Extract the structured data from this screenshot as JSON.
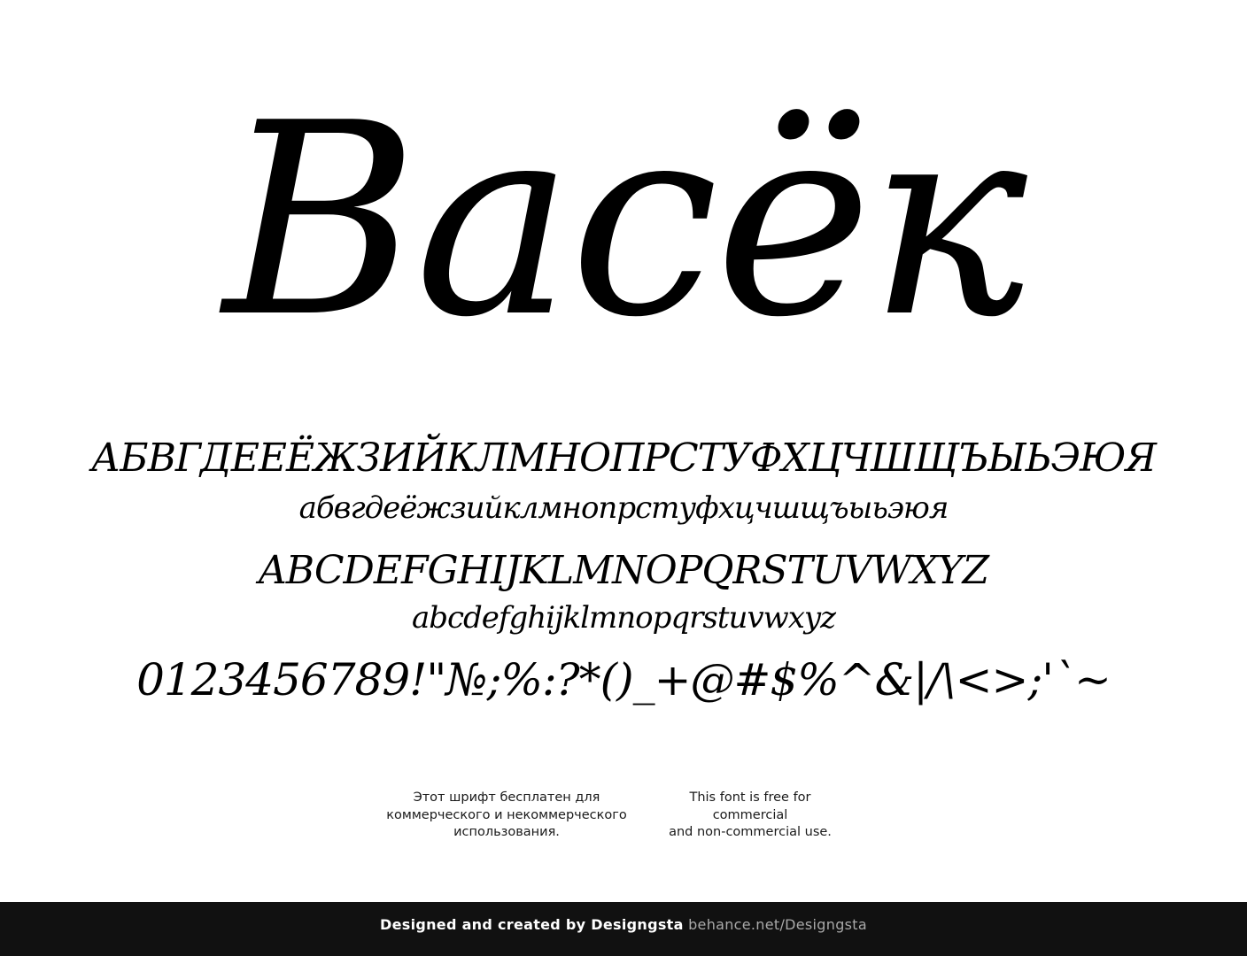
{
  "title": "Васёк",
  "glyph_lines": {
    "cyrillic_upper": "АБВГДЕЕЁЖЗИЙКЛМНОПРСТУФХЦЧШЩЪЫЬЭЮЯ",
    "cyrillic_lower": "абвгдеёжзийклмнопрстуфхцчшщъыьэюя",
    "latin_upper": "ABCDEFGHIJKLMNOPQRSTUVWXYZ",
    "latin_lower": "abcdefghijklmnopqrstuvwxyz",
    "numbers_symbols": "0123456789!\"№;%:?*()_+@#$%^&|/\\<>;'`~"
  },
  "license": {
    "ru_lines": [
      "Этот шрифт бесплатен для",
      "коммерческого и некоммерческого",
      "использования."
    ],
    "en_lines": [
      "This font is free for",
      "commercial",
      "and non-commercial use."
    ]
  },
  "footer": {
    "credit": "Designed and created by Designgsta",
    "link": "behance.net/Designgsta"
  },
  "colors": {
    "background": "#ffffff",
    "text": "#000000",
    "footer_background": "#111111",
    "footer_text": "#ffffff",
    "footer_link": "#a9a9a9"
  }
}
